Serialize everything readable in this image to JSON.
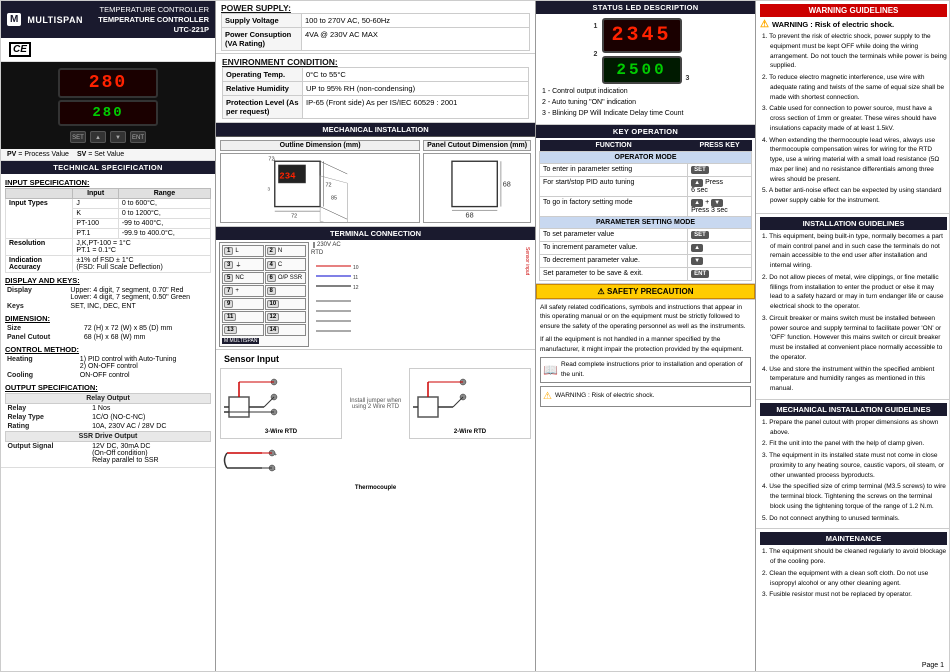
{
  "header": {
    "brand": "MULTISPAN",
    "model": "TEMPERATURE CONTROLLER\nUTC-221P"
  },
  "power_supply": {
    "title": "POWER SUPPLY:",
    "rows": [
      {
        "label": "Supply Voltage",
        "value": "100 to 270V AC, 50-60Hz"
      },
      {
        "label": "Power Consuption (VA Rating)",
        "value": "4VA @ 230V AC MAX"
      }
    ],
    "env_title": "ENVIRONMENT CONDITION:",
    "env_rows": [
      {
        "label": "Operating Temp.",
        "value": "0°C to 55°C"
      },
      {
        "label": "Relative Humidity",
        "value": "UP to 95% RH (non-condensing)"
      },
      {
        "label": "Protection Level (As per request)",
        "value": "IP-65 (Front side) As per IS/IEC 60529 : 2001"
      }
    ]
  },
  "mechanical_installation": {
    "title": "MECHANICAL INSTALLATION",
    "outline_dim_title": "Outline Dimension (mm)",
    "panel_cutout_title": "Panel Cutout Dimension (mm)",
    "dimensions": {
      "width": "72",
      "height": "72",
      "depth": "85",
      "display": "234",
      "panel_width": "68",
      "panel_height": "68"
    }
  },
  "terminal_connection": {
    "title": "TERMINAL CONNECTION",
    "terminals": [
      {
        "num": "1",
        "label": "L"
      },
      {
        "num": "2",
        "label": "N"
      },
      {
        "num": "3",
        "label": "⏚"
      },
      {
        "num": "4",
        "label": "C"
      },
      {
        "num": "5",
        "label": "NC"
      },
      {
        "num": "6",
        "label": "O/P SSR"
      },
      {
        "num": "7",
        "label": "+"
      },
      {
        "num": "8",
        "label": ""
      },
      {
        "num": "9",
        "label": ""
      },
      {
        "num": "10",
        "label": ""
      },
      {
        "num": "11",
        "label": ""
      },
      {
        "num": "12",
        "label": ""
      },
      {
        "num": "13",
        "label": ""
      },
      {
        "num": "14",
        "label": ""
      }
    ],
    "voltage_label": "230V AC",
    "rtd_label": "RTD",
    "sensor_input": "Sensor Input",
    "wiring": {
      "rtd_3wire": "3-Wire RTD",
      "rtd_2wire": "2-Wire RTD",
      "jumper_note": "Install jumper when using 2 Wire RTD"
    },
    "thermocouple_label": "Thermocouple"
  },
  "status_led": {
    "title": "STATUS LED DESCRIPTION",
    "display_top": "2345",
    "display_bottom": "2500",
    "labels": [
      {
        "num": "1",
        "text": "- Control output indication"
      },
      {
        "num": "2",
        "text": "- Auto tuning \"ON\" indication"
      },
      {
        "num": "3",
        "text": "- Blinking DP Will Indicate Delay time Count"
      }
    ]
  },
  "key_operation": {
    "title": "KEY OPERATION",
    "table": {
      "col1": "FUNCTION",
      "col2": "PRESS KEY",
      "operator_mode": "OPERATOR MODE",
      "rows_op": [
        {
          "func": "To enter in parameter setting",
          "key": "SET"
        },
        {
          "func": "For start/stop PID auto tuning",
          "key": "▲ Press 6 sec"
        },
        {
          "func": "To go in factory setting mode",
          "key": "▲ + ▼ Press 3 sec"
        }
      ],
      "param_mode": "PARAMETER SETTING MODE",
      "rows_param": [
        {
          "func": "To set parameter value",
          "key": "SET"
        },
        {
          "func": "To increment parameter value.",
          "key": "▲"
        },
        {
          "func": "To decrement parameter value.",
          "key": "▼"
        },
        {
          "func": "Set parameter to be save & exit.",
          "key": "ENT"
        }
      ]
    }
  },
  "safety_precaution": {
    "title": "SAFETY PRECAUTION",
    "text1": "All safety related codifications, symbols and instructions that appear in this operating manual or on the equipment must be strictly followed to ensure the safety of the operating personnel as well as the instruments.",
    "text2": "If all the equipment is not handled in a manner specified by the manufacturer, it might impair the protection provided by the equipment.",
    "read_complete": "Read complete instructions prior to installation and operation of the unit.",
    "warning": "WARNING : Risk of electric shock."
  },
  "warning_guidelines": {
    "title": "WARNING GUIDELINES",
    "warning_title": "WARNING : Risk of electric shock.",
    "points": [
      "1. To prevent the risk of electric shock, power supply to the equipment must be kept OFF while doing the wiring arrangement. Do not touch the terminals while power is being supplied.",
      "2. To reduce electro magnetic interference, use wire with adequate rating and twists of the same of equal size shall be made with shortest connection.",
      "3. Cable used for connection to power source, must have a cross section of 1mm or greater. These wires should have insulations capacity made of at least 1.5kV.",
      "4. When extending the thermocouple lead wires, always use thermocouple compensation wires for wiring for the RTD type, use a wiring material with a small load resistance (5Ω max per line) and no resistance differentials among three wires should be present.",
      "5. A better anti-noise effect can be expected by using standard power supply cable for the instrument."
    ]
  },
  "installation_guidelines": {
    "title": "INSTALLATION GUIDELINES",
    "points": [
      "1. This equipment, being built-in type, normally becomes a part of main control panel and in such case the terminals do not remain accessible to the end user after installation and internal wiring.",
      "2. Do not allow pieces of metal, wire clippings, or fine metallic fillings from installation to enter the product or else it may lead to a safety hazard or may in turn endanger life or cause electrical shock to the operator.",
      "3. Circuit  breaker or mains switch must be installed between power source and supply terminal to facilitate power 'ON' or 'OFF' function. However this mains switch or circuit breaker must be installed at convenient place normally accessible to the operator.",
      "4. Use and store the instrument within the specified ambient temperature and humidity ranges as mentioned in this manual."
    ]
  },
  "mechanical_installation_guidelines": {
    "title": "MECHANICAL INSTALLATION GUIDELINES",
    "points": [
      "1. Prepare the panel cutout with proper dimensions as shown above.",
      "2. Fit the unit into the panel with the help of clamp given.",
      "3. The equipment in its installed state must not come in close proximity to any heating source, caustic vapors, oil steam, or other unwanted process byproducts.",
      "4. Use the specified size of crimp terminal (M3.5 screws) to wire the terminal block. Tightening the screws on the terminal block using the tightening torque of the range of 1.2 N.m.",
      "5. Do not connect anything to unused terminals."
    ]
  },
  "maintenance": {
    "title": "MAINTENANCE",
    "points": [
      "1. The equipment should be cleaned regularly to avoid blockage of the cooling pore.",
      "2. Clean the equipment with a clean soft cloth. Do not use isopropyl alcohol or any other cleaning agent.",
      "3. Fusible resistor must not be replaced by operator."
    ]
  },
  "technical_spec": {
    "title": "TECHNICAL SPECIFICATION",
    "input_spec_title": "INPUT SPECIFICATION:",
    "input_types": {
      "header_input": "Input",
      "header_range": "Range",
      "rows": [
        {
          "type": "J",
          "range": "0 to 600°C,"
        },
        {
          "type": "K",
          "range": "0 to 1200°C,"
        },
        {
          "type": "PT-100",
          "range": "-99 to 400°C,"
        },
        {
          "type": "PT.1",
          "range": "-99.9 to 400.0°C,"
        },
        {
          "type": "J,K,PT-100",
          "range": "±1°C"
        },
        {
          "type": "PT.1",
          "range": "± 0.1°C"
        }
      ]
    },
    "display_keys_title": "DISPLAY AND KEYS:",
    "display": {
      "upper": "Upper: 4 digit, 7 segment, 0.70\" Red",
      "lower": "Lower: 4 digit, 7 segment, 0.50\" Green"
    },
    "keys": "SET, INC, DEC, ENT",
    "dimension_title": "DIMENSION:",
    "size": "72 (H) x 72 (W) x 85 (D) mm",
    "panel_cutout": "68 (H) x 68 (W) mm",
    "control_method_title": "CONTROL METHOD:",
    "heating": "1) PID control with Auto-Tuning\n2) ON-OFF control",
    "cooling": "ON-OFF control",
    "output_spec_title": "OUTPUT SPECIFICATION:",
    "relay_output_title": "Relay Output",
    "relay": "1 Nos",
    "relay_type": "1C/O (NO-C-NC)",
    "rating": "10A, 230V AC / 28V DC",
    "ssr_title": "SSR Drive Output",
    "output_signal": "12V DC, 30mA DC\n(On-Off condition)\nRelay parallel to SSR",
    "resolution_label": "Resolution",
    "resolution_val": "J,K,PT-100 = 1°C\nPT.1 = 0.1°C",
    "indication_label": "Indication Accuracy",
    "indication_val": "±1% of FSD ± 1°C\n(FSD: Full Scale Deflection)",
    "input_types_label": "Input Types"
  },
  "page_number": "Page 1"
}
